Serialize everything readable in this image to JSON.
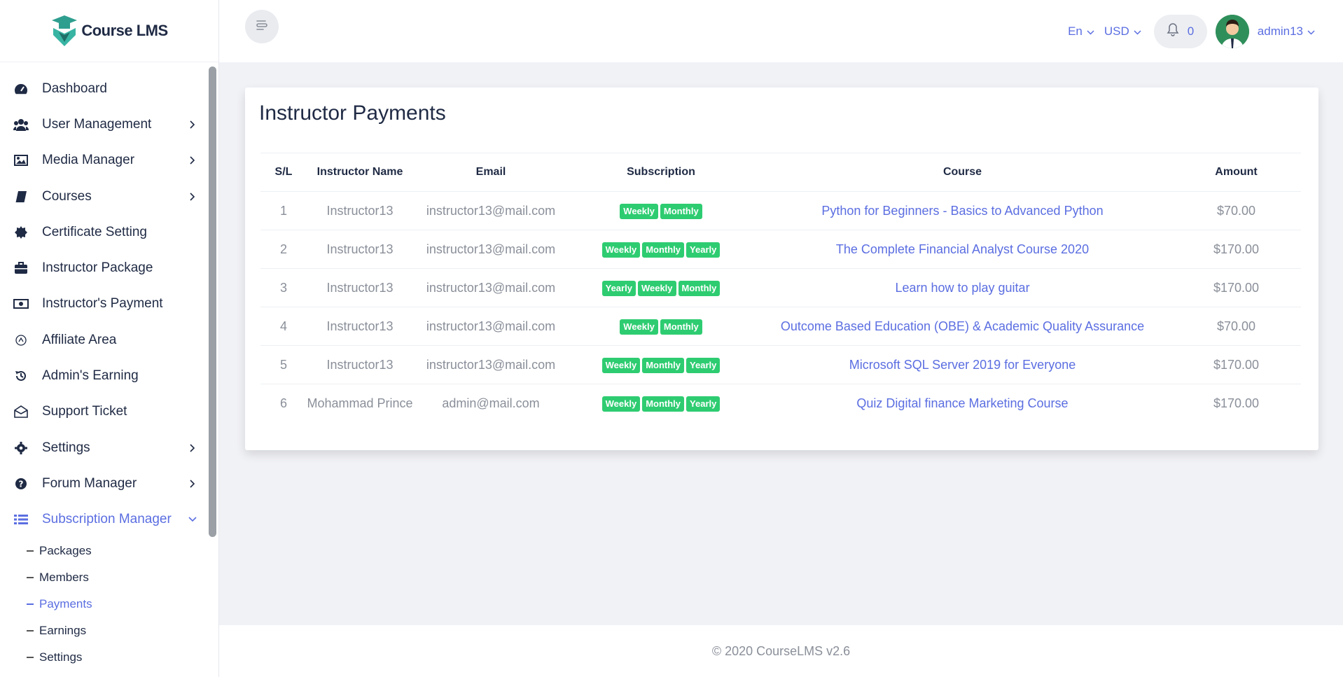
{
  "brand": {
    "name": "Course LMS"
  },
  "sidebar": {
    "items": [
      {
        "label": "Dashboard",
        "icon": "dashboard-icon",
        "chevron": false
      },
      {
        "label": "User Management",
        "icon": "users-icon",
        "chevron": true
      },
      {
        "label": "Media Manager",
        "icon": "image-icon",
        "chevron": true
      },
      {
        "label": "Courses",
        "icon": "book-icon",
        "chevron": true
      },
      {
        "label": "Certificate Setting",
        "icon": "certificate-icon",
        "chevron": false
      },
      {
        "label": "Instructor Package",
        "icon": "briefcase-icon",
        "chevron": false
      },
      {
        "label": "Instructor's Payment",
        "icon": "money-icon",
        "chevron": false
      },
      {
        "label": "Affiliate Area",
        "icon": "affiliate-icon",
        "chevron": false
      },
      {
        "label": "Admin's Earning",
        "icon": "history-icon",
        "chevron": false
      },
      {
        "label": "Support Ticket",
        "icon": "envelope-open-icon",
        "chevron": false
      },
      {
        "label": "Settings",
        "icon": "gear-icon",
        "chevron": true
      },
      {
        "label": "Forum Manager",
        "icon": "question-icon",
        "chevron": true
      },
      {
        "label": "Subscription Manager",
        "icon": "list-icon",
        "chevron": true,
        "active": true
      }
    ],
    "submenu": [
      {
        "label": "Packages"
      },
      {
        "label": "Members"
      },
      {
        "label": "Payments",
        "active": true
      },
      {
        "label": "Earnings"
      },
      {
        "label": "Settings"
      }
    ]
  },
  "header": {
    "language": "En",
    "currency": "USD",
    "notifications_count": "0",
    "username": "admin13"
  },
  "page": {
    "title": "Instructor Payments",
    "table": {
      "columns": [
        "S/L",
        "Instructor Name",
        "Email",
        "Subscription",
        "Course",
        "Amount"
      ],
      "rows": [
        {
          "sl": "1",
          "name": "Instructor13",
          "email": "instructor13@mail.com",
          "subscriptions": [
            "Weekly",
            "Monthly"
          ],
          "course": "Python for Beginners - Basics to Advanced Python",
          "amount": "$70.00"
        },
        {
          "sl": "2",
          "name": "Instructor13",
          "email": "instructor13@mail.com",
          "subscriptions": [
            "Weekly",
            "Monthly",
            "Yearly"
          ],
          "course": "The Complete Financial Analyst Course 2020",
          "amount": "$170.00"
        },
        {
          "sl": "3",
          "name": "Instructor13",
          "email": "instructor13@mail.com",
          "subscriptions": [
            "Yearly",
            "Weekly",
            "Monthly"
          ],
          "course": "Learn how to play guitar",
          "amount": "$170.00"
        },
        {
          "sl": "4",
          "name": "Instructor13",
          "email": "instructor13@mail.com",
          "subscriptions": [
            "Weekly",
            "Monthly"
          ],
          "course": "Outcome Based Education (OBE) & Academic Quality Assurance",
          "amount": "$70.00"
        },
        {
          "sl": "5",
          "name": "Instructor13",
          "email": "instructor13@mail.com",
          "subscriptions": [
            "Weekly",
            "Monthly",
            "Yearly"
          ],
          "course": "Microsoft SQL Server 2019 for Everyone",
          "amount": "$170.00"
        },
        {
          "sl": "6",
          "name": "Mohammad Prince",
          "email": "admin@mail.com",
          "subscriptions": [
            "Weekly",
            "Monthly",
            "Yearly"
          ],
          "course": "Quiz Digital finance Marketing Course",
          "amount": "$170.00"
        }
      ]
    }
  },
  "footer": {
    "text": "© 2020 CourseLMS v2.6"
  },
  "colors": {
    "accent": "#5b6ee1",
    "badge": "#2ecc71",
    "text": "#1f2a44",
    "muted": "#8a8f99"
  }
}
